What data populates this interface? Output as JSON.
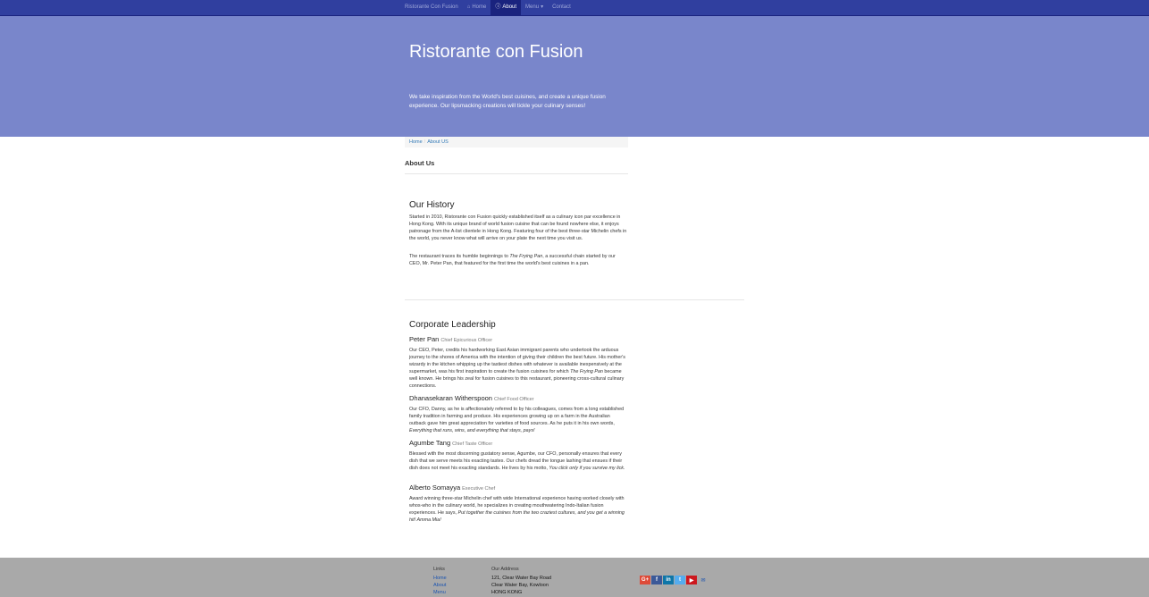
{
  "navbar": {
    "brand": "Ristorante Con Fusion",
    "items": [
      {
        "label": "Home",
        "icon": "home-icon"
      },
      {
        "label": "About",
        "icon": "info-icon"
      },
      {
        "label": "Menu",
        "icon": ""
      },
      {
        "label": "Contact",
        "icon": ""
      }
    ],
    "menu_caret": "▾"
  },
  "jumbotron": {
    "title": "Ristorante con Fusion",
    "text": "We take inspiration from the World's best cuisines, and create a unique fusion experience. Our lipsmacking creations will tickle your culinary senses!"
  },
  "breadcrumb": {
    "home": "Home",
    "current": "About US",
    "separator": "/"
  },
  "page_title": "About Us",
  "history": {
    "title": "Our History",
    "para1": "Started in 2010, Ristorante con Fusion quickly established itself as a culinary icon par excellence in Hong Kong. With its unique brand of world fusion cuisine that can be found nowhere else, it enjoys patronage from the A-list clientele in Hong Kong. Featuring four of the best three-star Michelin chefs in the world, you never know what will arrive on your plate the next time you visit us.",
    "para2_before": "The restaurant traces its humble beginnings to ",
    "para2_em": "The Frying Pan",
    "para2_after": ", a successful chain started by our CEO, Mr. Peter Pan, that featured for the first time the world's best cuisines in a pan."
  },
  "leadership": {
    "title": "Corporate Leadership",
    "leaders": [
      {
        "name": "Peter Pan",
        "designation": "Chief Epicurious Officer",
        "desc_before": "Our CEO, Peter, credits his hardworking East Asian immigrant parents who undertook the arduous journey to the shores of America with the intention of giving their children the best future. His mother's wizardy in the kitchen whipping up the tastiest dishes with whatever is available inexpensively at the supermarket, was his first inspiration to create the fusion cuisines for which ",
        "desc_em": "The Frying Pan",
        "desc_after": " became well known. He brings his zeal for fusion cuisines to this restaurant, pioneering cross-cultural culinary connections."
      },
      {
        "name": "Dhanasekaran Witherspoon",
        "designation": "Chief Food Officer",
        "desc_before": "Our CFO, Danny, as he is affectionately referred to by his colleagues, comes from a long established family tradition in farming and produce. His experiences growing up on a farm in the Australian outback gave him great appreciation for varieties of food sources. As he puts it in his own words, ",
        "desc_em": "Everything that runs, wins, and everything that stays, pays!",
        "desc_after": ""
      },
      {
        "name": "Agumbe Tang",
        "designation": "Chief Taste Officer",
        "desc_before": "Blessed with the most discerning gustatory sense, Agumbe, our CFO, personally ensures that every dish that we serve meets his exacting tastes. Our chefs dread the tongue lashing that ensues if their dish does not meet his exacting standards. He lives by his motto, ",
        "desc_em": "You click only if you survive my lick.",
        "desc_after": ""
      },
      {
        "name": "Alberto Somayya",
        "designation": "Executive Chef",
        "desc_before": "Award winning three-star Michelin chef with wide International experience having worked closely with whos-who in the culinary world, he specializes in creating mouthwatering Indo-Italian fusion experiences. He says, ",
        "desc_em": "Put together the cuisines from the two craziest cultures, and you get a winning hit! Amma Mia!",
        "desc_after": ""
      }
    ]
  },
  "footer": {
    "links_title": "Links",
    "links": [
      "Home",
      "About",
      "Menu"
    ],
    "address_title": "Our Address",
    "address_lines": [
      "121, Clear Water Bay Road",
      "Clear Water Bay, Kowloon",
      "HONG KONG"
    ],
    "social": [
      {
        "name": "google-plus",
        "glyph": "G+"
      },
      {
        "name": "facebook",
        "glyph": "f"
      },
      {
        "name": "linkedin",
        "glyph": "in"
      },
      {
        "name": "twitter",
        "glyph": "t"
      },
      {
        "name": "youtube",
        "glyph": "▶"
      },
      {
        "name": "mail",
        "glyph": "✉"
      }
    ]
  },
  "colors": {
    "navbar": "#303F9F",
    "jumbotron": "#7986CB",
    "footer": "#A9A9A9",
    "link": "#337AB7"
  }
}
